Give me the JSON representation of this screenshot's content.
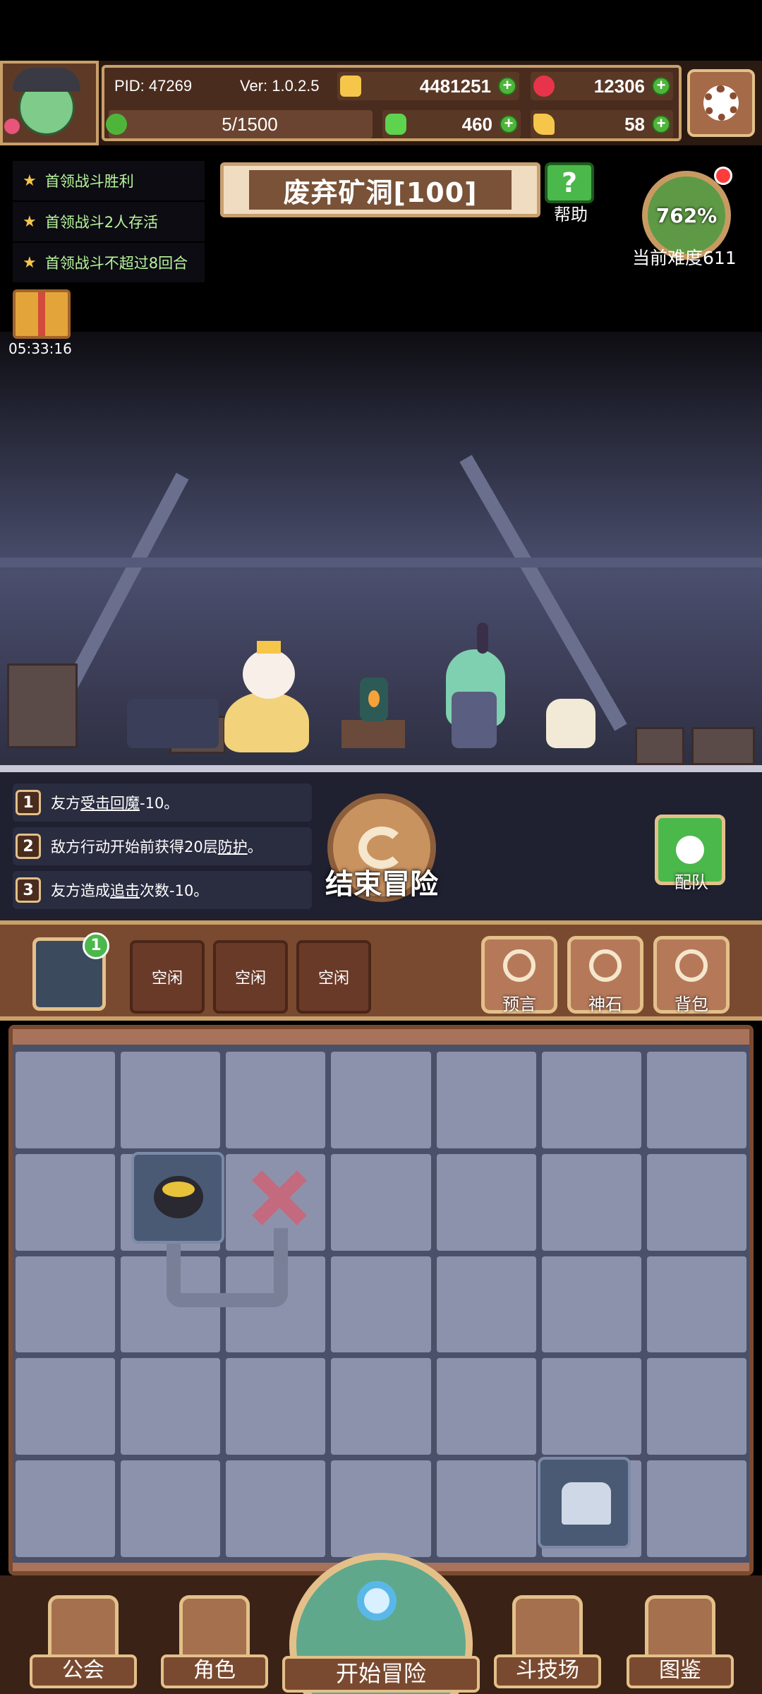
{
  "header": {
    "pid": "PID: 47269",
    "version": "Ver: 1.0.2.5",
    "gold": "4481251",
    "gems": "12306",
    "stamina": "5/1500",
    "clover": "460",
    "key": "58",
    "colors": {
      "gold": "#f5c64a",
      "gem": "#e8344a",
      "stamina": "#4fb53a",
      "accent": "#c9a06a"
    }
  },
  "quests": [
    {
      "label": "首领战斗胜利"
    },
    {
      "label": "首领战斗2人存活"
    },
    {
      "label": "首领战斗不超过8回合"
    }
  ],
  "level": {
    "title": "废弃矿洞[100]",
    "help_label": "帮助"
  },
  "difficulty": {
    "percent": "762%",
    "label": "当前难度611"
  },
  "gift": {
    "timer": "05:33:16"
  },
  "effects": [
    {
      "num": "1",
      "pre": "友方",
      "keyword": "受击回魔",
      "post": "-10。"
    },
    {
      "num": "2",
      "pre": "敌方行动开始前获得20层",
      "keyword": "防护",
      "post": "。"
    },
    {
      "num": "3",
      "pre": "友方造成",
      "keyword": "追击",
      "post": "次数-10。"
    }
  ],
  "end_adventure": {
    "label": "结束冒险"
  },
  "team": {
    "label": "配队"
  },
  "slots": {
    "main_count": "1",
    "idle": [
      "空闲",
      "空闲",
      "空闲"
    ]
  },
  "tools": {
    "prophecy": "预言",
    "godstone": "神石",
    "bag": "背包"
  },
  "nav": {
    "guild": "公会",
    "character": "角色",
    "adventure": "开始冒险",
    "arena": "斗技场",
    "codex": "图鉴"
  }
}
